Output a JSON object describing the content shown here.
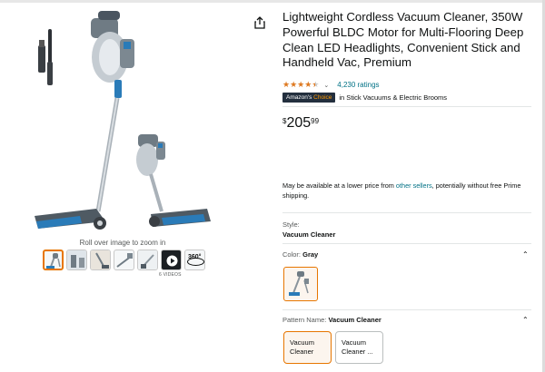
{
  "product": {
    "title": "Lightweight Cordless Vacuum Cleaner, 350W Powerful BLDC Motor for Multi-Flooring Deep Clean LED Headlights, Convenient Stick and Handheld Vac, Premium",
    "rating_value": 4.5,
    "rating_count": "4,230 ratings",
    "badge_prefix": "Amazon's",
    "badge_word": "Choice",
    "badge_category": "in Stick Vacuums & Electric Brooms",
    "price_symbol": "$",
    "price_whole": "205",
    "price_fraction": "99"
  },
  "availability": {
    "text_before": "May be available at a lower price from ",
    "link": "other sellers",
    "text_after": ", potentially without free Prime shipping."
  },
  "gallery": {
    "zoom_hint": "Roll over image to zoom in",
    "videos_label": "6 VIDEOS",
    "thumb_360_label": "360°"
  },
  "style": {
    "label": "Style:",
    "value": "Vacuum Cleaner"
  },
  "color": {
    "label": "Color:",
    "value": "Gray"
  },
  "pattern": {
    "label": "Pattern Name:",
    "value": "Vacuum Cleaner",
    "options": [
      {
        "line1": "Vacuum",
        "line2": "Cleaner"
      },
      {
        "line1": "Vacuum",
        "line2": "Cleaner ..."
      }
    ]
  },
  "colors": {
    "accent": "#e77600",
    "link": "#007185",
    "star": "#de7921",
    "badge_bg": "#232f3e"
  },
  "icons": {
    "share": "share-icon",
    "expand": "chevron-up-icon"
  }
}
